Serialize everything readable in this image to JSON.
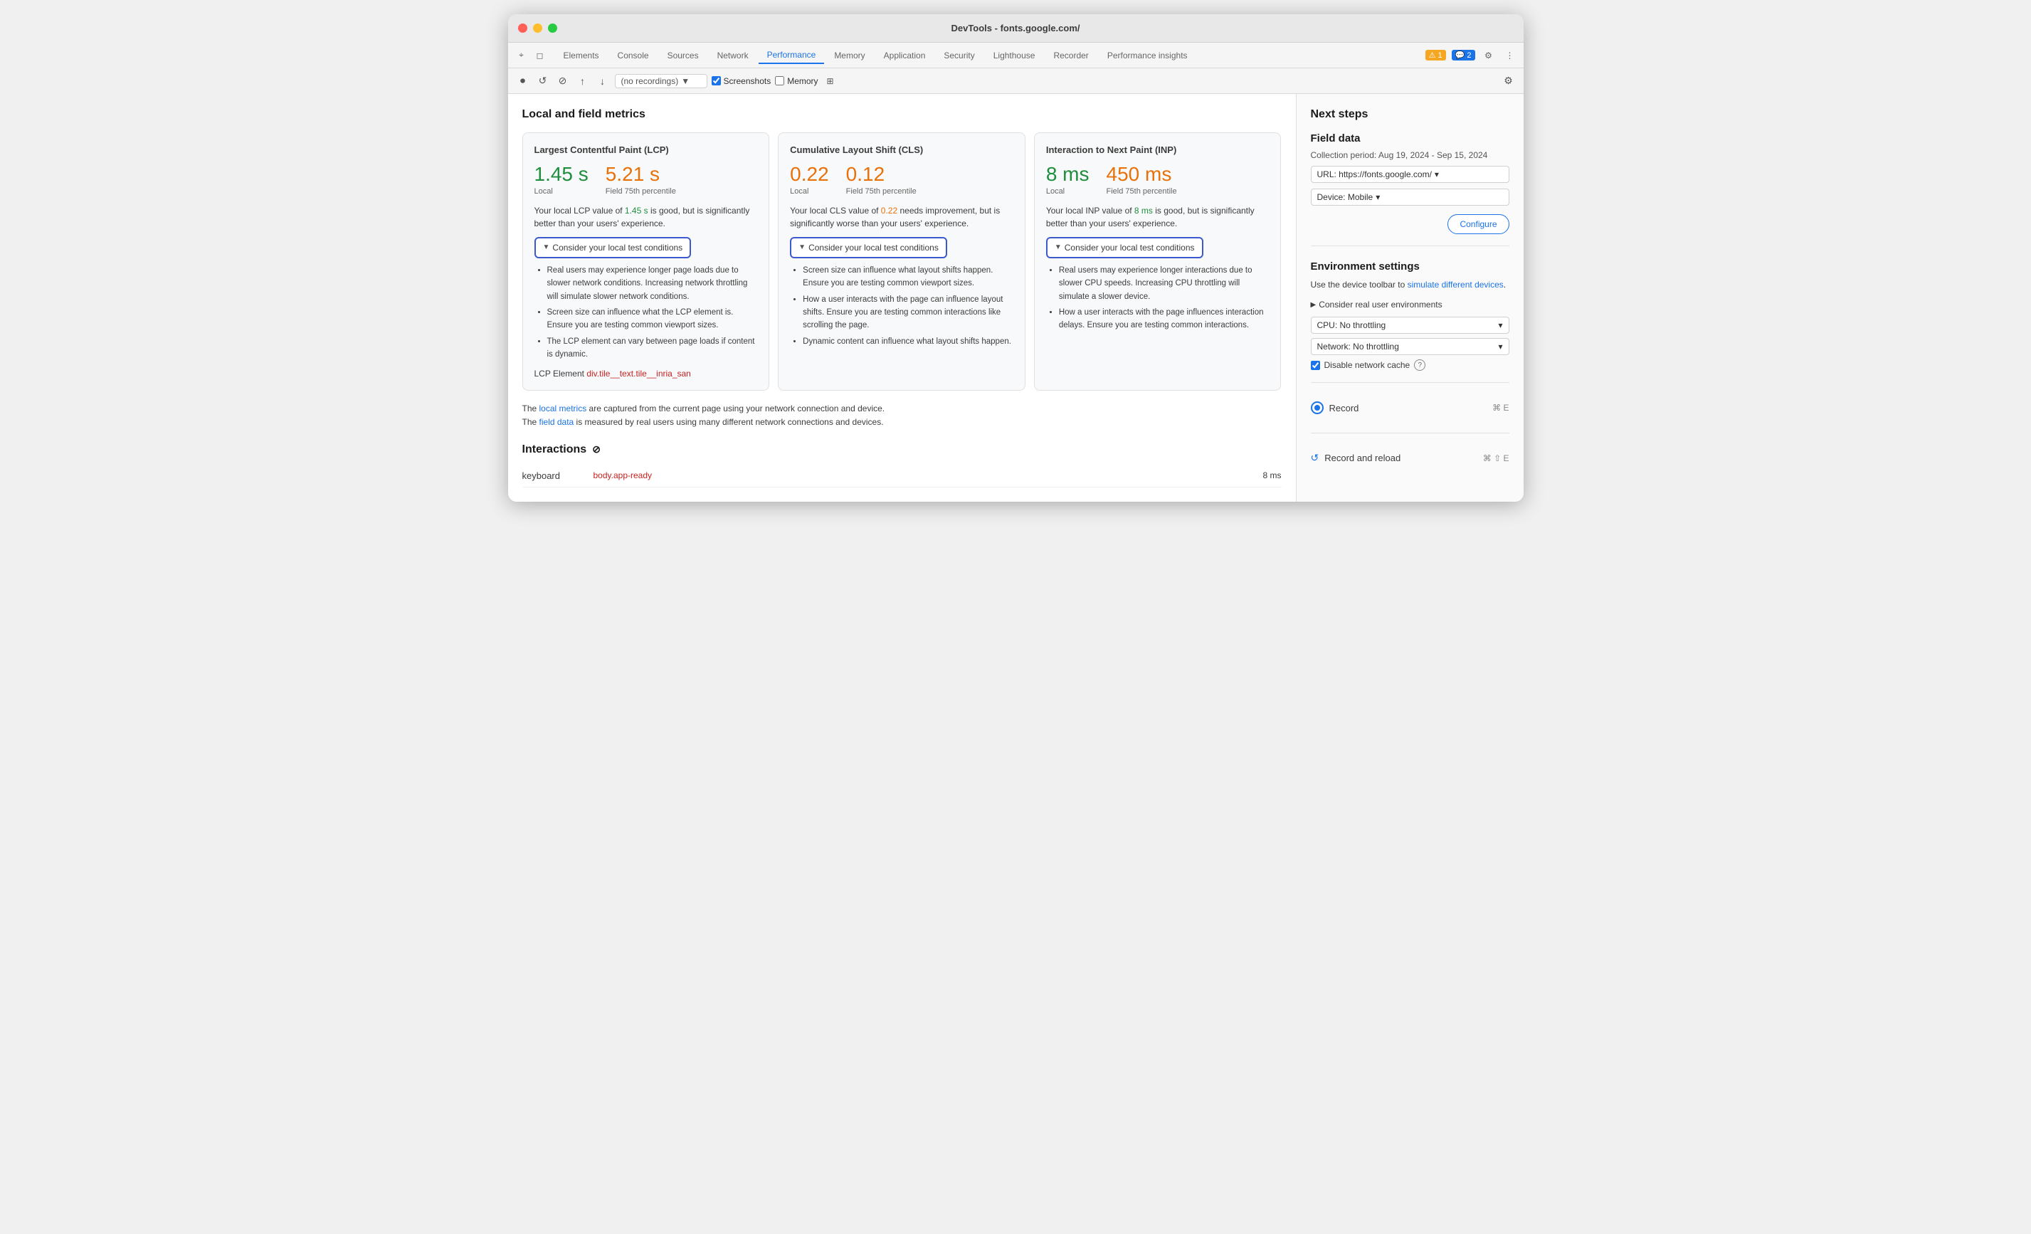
{
  "window": {
    "title": "DevTools - fonts.google.com/"
  },
  "tabs": {
    "items": [
      "Elements",
      "Console",
      "Sources",
      "Network",
      "Performance",
      "Memory",
      "Application",
      "Security",
      "Lighthouse",
      "Recorder",
      "Performance insights"
    ],
    "active": "Performance"
  },
  "toolbar": {
    "dropdown_placeholder": "(no recordings)",
    "screenshots_label": "Screenshots",
    "memory_label": "Memory"
  },
  "left": {
    "section_title": "Local and field metrics",
    "cards": [
      {
        "title": "Largest Contentful Paint (LCP)",
        "local_value": "1.45 s",
        "local_label": "Local",
        "field_value": "5.21 s",
        "field_label": "Field 75th percentile",
        "local_color": "green",
        "field_color": "orange",
        "description": "Your local LCP value of 1.45 s is good, but is significantly better than your users' experience.",
        "desc_highlight": "1.45 s",
        "desc_highlight_color": "green",
        "consider_label": "Consider your local test conditions",
        "bullets": [
          "Real users may experience longer page loads due to slower network conditions. Increasing network throttling will simulate slower network conditions.",
          "Screen size can influence what the LCP element is. Ensure you are testing common viewport sizes.",
          "The LCP element can vary between page loads if content is dynamic."
        ],
        "lcp_element_label": "LCP Element",
        "lcp_element_value": "div.tile__text.tile__inria_san"
      },
      {
        "title": "Cumulative Layout Shift (CLS)",
        "local_value": "0.22",
        "local_label": "Local",
        "field_value": "0.12",
        "field_label": "Field 75th percentile",
        "local_color": "orange",
        "field_color": "orange",
        "description": "Your local CLS value of 0.22 needs improvement, but is significantly worse than your users' experience.",
        "desc_highlight": "0.22",
        "desc_highlight_color": "orange",
        "consider_label": "Consider your local test conditions",
        "bullets": [
          "Screen size can influence what layout shifts happen. Ensure you are testing common viewport sizes.",
          "How a user interacts with the page can influence layout shifts. Ensure you are testing common interactions like scrolling the page.",
          "Dynamic content can influence what layout shifts happen."
        ]
      },
      {
        "title": "Interaction to Next Paint (INP)",
        "local_value": "8 ms",
        "local_label": "Local",
        "field_value": "450 ms",
        "field_label": "Field 75th percentile",
        "local_color": "green",
        "field_color": "orange",
        "description": "Your local INP value of 8 ms is good, but is significantly better than your users' experience.",
        "desc_highlight": "8 ms",
        "desc_highlight_color": "green",
        "consider_label": "Consider your local test conditions",
        "bullets": [
          "Real users may experience longer interactions due to slower CPU speeds. Increasing CPU throttling will simulate a slower device.",
          "How a user interacts with the page influences interaction delays. Ensure you are testing common interactions."
        ]
      }
    ],
    "footer_note_1": "The local metrics are captured from the current page using your network connection and device.",
    "footer_note_2": "The field data is measured by real users using many different network connections and devices.",
    "local_metrics_link": "local metrics",
    "field_data_link": "field data",
    "interactions_title": "Interactions",
    "interactions": [
      {
        "name": "keyboard",
        "element": "body.app-ready",
        "time": "8 ms"
      }
    ]
  },
  "right": {
    "section_title": "Next steps",
    "field_data_title": "Field data",
    "collection_period": "Collection period: Aug 19, 2024 - Sep 15, 2024",
    "url_label": "URL: https://fonts.google.com/",
    "device_label": "Device: Mobile",
    "configure_label": "Configure",
    "env_settings_title": "Environment settings",
    "env_desc_1": "Use the device toolbar to",
    "env_desc_link": "simulate different devices",
    "env_desc_2": ".",
    "consider_real_label": "Consider real user environments",
    "cpu_label": "CPU: No throttling",
    "network_label": "Network: No throttling",
    "disable_cache_label": "Disable network cache",
    "record_label": "Record",
    "record_shortcut": "⌘ E",
    "record_reload_label": "Record and reload",
    "record_reload_shortcut": "⌘ ⇧ E"
  }
}
